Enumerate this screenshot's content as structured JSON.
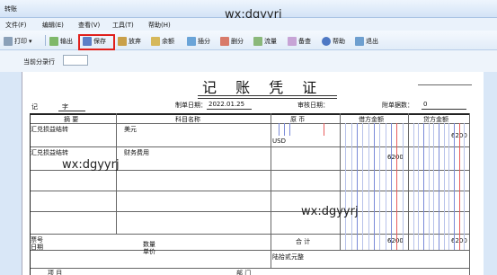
{
  "window": {
    "title": "转账"
  },
  "watermark": "wx:dgyyrj",
  "menu": [
    "文件(F)",
    "编辑(E)",
    "查看(V)",
    "工具(T)",
    "帮助(H)"
  ],
  "toolbar": {
    "print": "打印",
    "export": "输出",
    "save": "保存",
    "discard": "放弃",
    "balance": "余额",
    "insert_entry": "插分",
    "delete_entry": "删分",
    "cash_flow": "流量",
    "memo": "备查",
    "help": "帮助",
    "exit": "退出"
  },
  "current_entry_label": "当前分录行",
  "voucher": {
    "title": "记 账 凭 证",
    "word_label": "记",
    "word_suffix": "字",
    "date_label": "制单日期：",
    "date": "2022.01.25",
    "audit_label": "审核日期：",
    "attachments_label": "附单据数：",
    "attachments": "0",
    "headers": {
      "summary": "摘 要",
      "account": "科目名称",
      "original_currency": "原 币",
      "debit": "借方金额",
      "credit": "贷方金额"
    },
    "rows": [
      {
        "summary": "汇兑损益结转",
        "account": "美元",
        "original_currency": "USD",
        "debit": "",
        "credit": "6200"
      },
      {
        "summary": "汇兑损益结转",
        "account": "财务费用",
        "original_currency": "",
        "debit": "6200",
        "credit": ""
      }
    ],
    "footer": {
      "ticket_no": "票号",
      "date": "日期",
      "quantity": "数量",
      "unit_price": "单价",
      "total_label": "合 计",
      "total_debit": "6200",
      "total_credit": "6200",
      "amount_in_words": "陆拾贰元整",
      "project_label": "项 目",
      "department_label": "部 门"
    }
  },
  "colors": {
    "save_highlight": "#e0201c",
    "money_digit_line": "#6c7fd0",
    "money_unit_line": "#e24040"
  }
}
